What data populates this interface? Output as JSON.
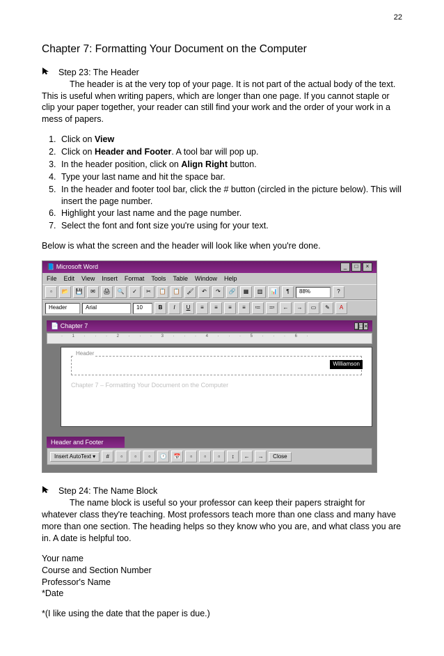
{
  "page_number": "22",
  "chapter_title": "Chapter 7: Formatting Your Document on the Computer",
  "step23": {
    "heading": "Step 23: The Header",
    "intro": "The header is at the very top of your page. It is not part of the actual body of the text. This is useful when writing papers, which are longer than one page. If you cannot staple or clip your paper together, your reader can still find your work and the order of your work in a mess of papers.",
    "list": [
      {
        "pre": "Click on ",
        "bold": "View",
        "post": ""
      },
      {
        "pre": "Click on ",
        "bold": "Header and Footer",
        "post": ". A tool bar will pop up."
      },
      {
        "pre": "In the header position, click on ",
        "bold": "Align Right",
        "post": " button."
      },
      {
        "pre": "Type your last name and hit the space bar.",
        "bold": "",
        "post": ""
      },
      {
        "pre": "In the header and footer tool bar, click the # button (circled in the picture below). This will insert the page number.",
        "bold": "",
        "post": ""
      },
      {
        "pre": "Highlight your last name and the page number.",
        "bold": "",
        "post": ""
      },
      {
        "pre": "Select the font and font size you're using for your text.",
        "bold": "",
        "post": ""
      }
    ],
    "below_text": "Below is what the screen and the header will look like when you're done."
  },
  "mock": {
    "app_title": "Microsoft Word",
    "menus": [
      "File",
      "Edit",
      "View",
      "Insert",
      "Format",
      "Tools",
      "Table",
      "Window",
      "Help"
    ],
    "style_sel": "Header",
    "font_sel": "Arial",
    "size_sel": "10",
    "zoom": "88%",
    "doc_title": "Chapter 7",
    "header_label": "Header",
    "header_name": "Williamson",
    "ghost_text": "Chapter 7 – Formatting Your Document on the Computer",
    "hf_title": "Header and Footer",
    "insert_autotext": "Insert AutoText",
    "close": "Close"
  },
  "step24": {
    "heading": "Step 24: The Name Block",
    "intro": "The name block is useful so your professor can keep their papers straight for whatever class they're teaching. Most professors teach more than one class and many have more than one section. The heading helps so they know who you are, and what class you are in. A date is helpful too.",
    "lines": [
      "Your name",
      "Course and Section Number",
      "Professor's Name",
      "*Date"
    ],
    "note": "*(I like using the date that the paper is due.)"
  }
}
